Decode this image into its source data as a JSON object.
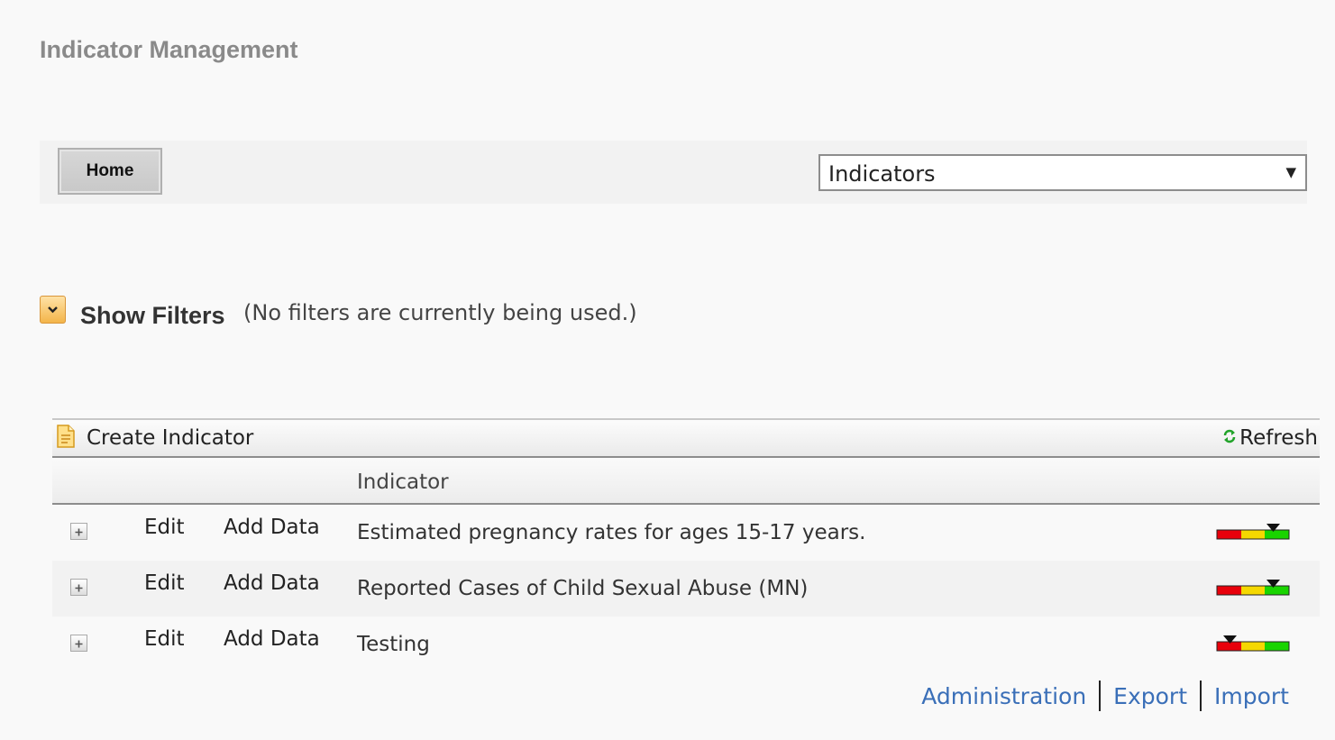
{
  "page": {
    "title": "Indicator Management"
  },
  "toolbar": {
    "home_label": "Home",
    "view_select": {
      "selected": "Indicators",
      "arrow": "▼"
    }
  },
  "filters": {
    "toggle_label": "Show Filters",
    "status_note": "(No filters are currently being used.)"
  },
  "grid": {
    "create_label": "Create Indicator",
    "refresh_label": "Refresh",
    "column_indicator": "Indicator",
    "rows": [
      {
        "edit": "Edit",
        "add_data": "Add Data",
        "name": "Estimated pregnancy rates for ages 15-17 years.",
        "gauge_marker": "green"
      },
      {
        "edit": "Edit",
        "add_data": "Add Data",
        "name": "Reported Cases of Child Sexual Abuse (MN)",
        "gauge_marker": "green"
      },
      {
        "edit": "Edit",
        "add_data": "Add Data",
        "name": "Testing",
        "gauge_marker": "red"
      }
    ]
  },
  "footer": {
    "administration": "Administration",
    "export": "Export",
    "import": "Import"
  },
  "colors": {
    "title_gray": "#8a8a8a",
    "link_blue": "#3a6fb8",
    "gauge_red": "#e8000b",
    "gauge_yellow": "#f5d800",
    "gauge_green": "#19d400"
  }
}
